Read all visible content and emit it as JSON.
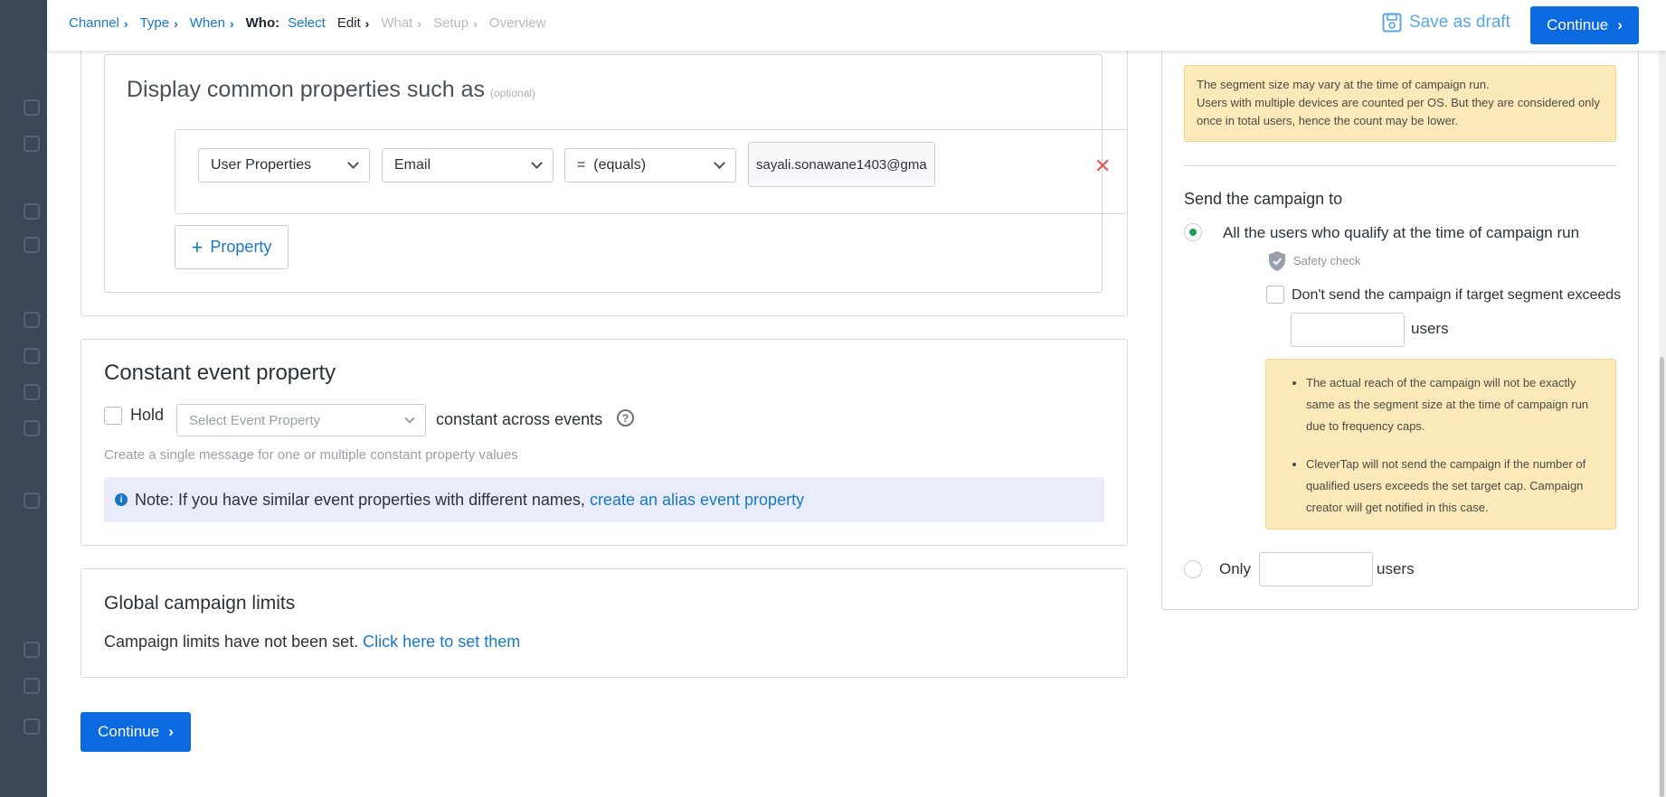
{
  "breadcrumb": {
    "steps": [
      {
        "label": "Channel"
      },
      {
        "label": "Type"
      },
      {
        "label": "When"
      },
      {
        "label": "Who:"
      },
      {
        "label": "Select"
      },
      {
        "label": "Edit"
      },
      {
        "label": "What"
      },
      {
        "label": "Setup"
      },
      {
        "label": "Overview"
      }
    ]
  },
  "header": {
    "save_draft_label": "Save as draft",
    "continue_label": "Continue"
  },
  "common_properties": {
    "title": "Display common properties such as",
    "optional_tag": "(optional)",
    "filter": {
      "property_type": "User Properties",
      "property": "Email",
      "operator": "=  (equals)",
      "value": "sayali.sonawane1403@gma"
    },
    "remove_symbol": "✕",
    "add_property_plus": "+",
    "add_property_label": "Property"
  },
  "constant_event": {
    "title": "Constant event property",
    "hold_label": "Hold",
    "select_placeholder": "Select Event Property",
    "constant_label": "constant across events",
    "help_symbol": "?",
    "description": "Create a single message for one or multiple constant property values",
    "note_info_symbol": "i",
    "note_text": "Note: If you have similar event properties with different names,",
    "note_link": "create an alias event property"
  },
  "global_limits": {
    "title": "Global campaign limits",
    "text": "Campaign limits have not been set.",
    "link": "Click here to set them"
  },
  "footer": {
    "continue_label": "Continue"
  },
  "segment_info": {
    "line1": "The segment size may vary at the time of campaign run.",
    "line2": "Users with multiple devices are counted per OS. But they are considered only once in total users, hence the count may be lower."
  },
  "send_to": {
    "title": "Send the campaign to",
    "all_users_label": "All the users who qualify at the time of campaign run",
    "all_users_selected": true,
    "safety_check_label": "Safety check",
    "dont_send_label": "Don't send the campaign if target segment exceeds",
    "cap_value": "",
    "users_label": "users",
    "notes": [
      "The actual reach of the campaign will not be exactly same as the segment size at the time of campaign run due to frequency caps.",
      "CleverTap will not send the campaign if the number of qualified users exceeds the set target cap. Campaign creator will get notified in this case."
    ],
    "only_label": "Only",
    "only_value": "",
    "only_users_label": "users"
  },
  "colors": {
    "primary": "#0c6ae1",
    "link": "#1778c8",
    "remove": "#e35a4f",
    "radio_selected": "#1e9e52",
    "warning_bg": "#fbe9ba",
    "note_bg": "#e9ecfb"
  }
}
